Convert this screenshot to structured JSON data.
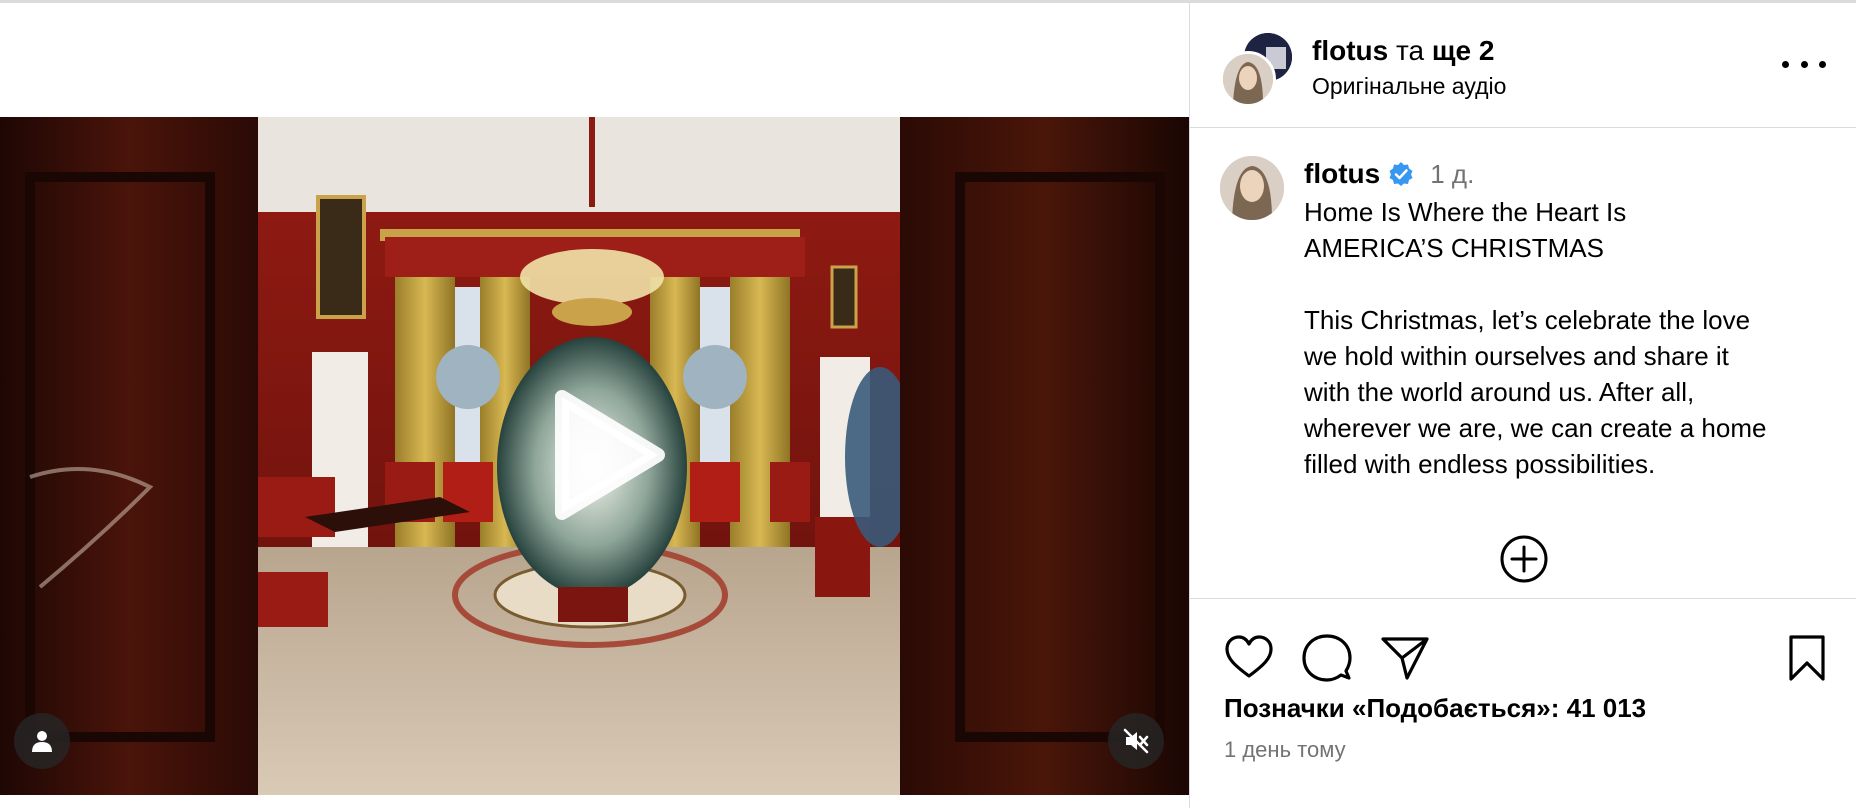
{
  "post": {
    "collab": {
      "primary_user": "flotus",
      "joiner": "та",
      "others": "ще 2",
      "audio": "Оригінальне аудіо"
    },
    "caption": {
      "username": "flotus",
      "verified": true,
      "time": "1 д.",
      "lines": [
        "Home Is Where the Heart Is",
        "AMERICA’S CHRISTMAS",
        "",
        "This Christmas, let’s celebrate the love",
        "we hold within ourselves and share it",
        "with the world around us. After all,",
        "wherever we are, we can create a home",
        "filled with endless possibilities."
      ]
    },
    "stats": {
      "likes": "Позначки «Подобається»: 41 013",
      "time_ago": "1 день тому"
    }
  },
  "icons": {
    "more": "more-options-icon",
    "verified": "verified-badge-icon",
    "add": "add-circle-icon",
    "like": "heart-icon",
    "comment": "comment-icon",
    "share": "paper-plane-icon",
    "save": "bookmark-icon",
    "play": "play-icon",
    "user_tag": "user-icon",
    "mute": "speaker-muted-icon"
  },
  "colors": {
    "verified": "#3897f0",
    "secondary_text": "#737373",
    "divider": "#dbdbdb"
  }
}
